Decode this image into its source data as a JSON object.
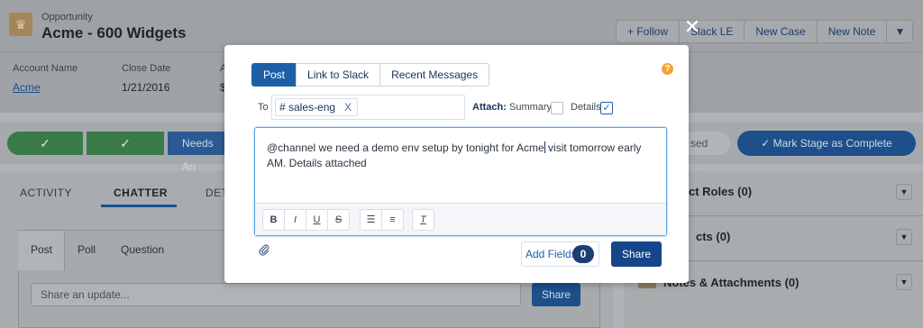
{
  "header": {
    "object_label": "Opportunity",
    "title": "Acme - 600 Widgets",
    "buttons": [
      "+ Follow",
      "Slack LE",
      "New Case",
      "New Note"
    ]
  },
  "fields": [
    {
      "label": "Account Name",
      "value": "Acme"
    },
    {
      "label": "Close Date",
      "value": "1/21/2016"
    },
    {
      "label": "A",
      "value": "$"
    }
  ],
  "path": {
    "active_stage": "Needs An",
    "trailing_text": "sed",
    "mark_button": "Mark Stage as Complete"
  },
  "tabs": [
    "ACTIVITY",
    "CHATTER",
    "DET"
  ],
  "chatter": {
    "tabs": [
      "Post",
      "Poll",
      "Question"
    ],
    "placeholder": "Share an update...",
    "share": "Share"
  },
  "related": [
    {
      "label": "ct Roles (0)"
    },
    {
      "label": "cts (0)"
    },
    {
      "label": "Notes & Attachments (0)"
    }
  ],
  "modal": {
    "tabs": [
      "Post",
      "Link to Slack",
      "Recent Messages"
    ],
    "to_label": "To",
    "channel": "# sales-eng",
    "channel_remove": "X",
    "attach_label": "Attach:",
    "attach_summary": "Summary",
    "attach_details": "Details",
    "message_before_caret": "@channel  we need a demo env setup by tonight for Acme",
    "message_after_caret": " visit tomorrow early AM. Details attached",
    "toolbar": {
      "bold": "B",
      "italic": "I",
      "underline": "U",
      "strike": "S",
      "clear": "T"
    },
    "add_fields": "Add Fields",
    "add_fields_count": "0",
    "share": "Share"
  },
  "colors": {
    "brand_blue": "#1d5fa6",
    "share_blue": "#16468a",
    "help_orange": "#f2a537"
  }
}
